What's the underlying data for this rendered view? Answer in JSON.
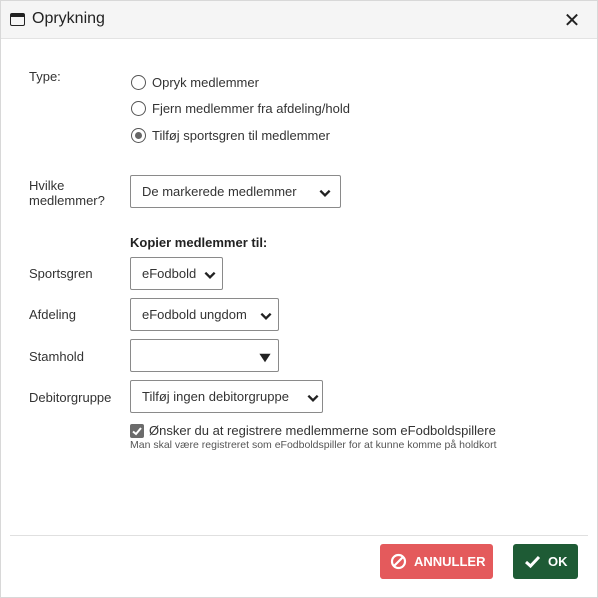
{
  "dialog": {
    "title": "Oprykning",
    "close_glyph": "✕"
  },
  "form": {
    "type_label": "Type:",
    "type_options": [
      {
        "label": "Opryk medlemmer",
        "checked": false
      },
      {
        "label": "Fjern medlemmer fra afdeling/hold",
        "checked": false
      },
      {
        "label": "Tilføj sportsgren til medlemmer",
        "checked": true
      }
    ],
    "which_members_label_line1": "Hvilke",
    "which_members_label_line2": "medlemmer?",
    "which_members_value": "De markerede medlemmer",
    "copy_heading": "Kopier medlemmer til:",
    "sport_label": "Sportsgren",
    "sport_value": "eFodbold",
    "department_label": "Afdeling",
    "department_value": "eFodbold ungdom",
    "team_label": "Stamhold",
    "team_value": "",
    "debtor_label": "Debitorgruppe",
    "debtor_value": "Tilføj ingen debitorgruppe",
    "register_checkbox_label": "Ønsker du at registrere medlemmerne som eFodboldspillere",
    "register_checked": true,
    "register_hint": "Man skal være registreret som eFodboldspiller for at kunne komme på holdkort"
  },
  "footer": {
    "cancel_label": "ANNULLER",
    "ok_label": "OK"
  },
  "colors": {
    "cancel": "#e45a5c",
    "ok": "#1e5b35"
  },
  "icons": {
    "title": "window-icon",
    "close": "close-icon",
    "cancel": "ban-icon",
    "ok": "checkmark-icon",
    "dropdown": "chevron-down-icon"
  }
}
